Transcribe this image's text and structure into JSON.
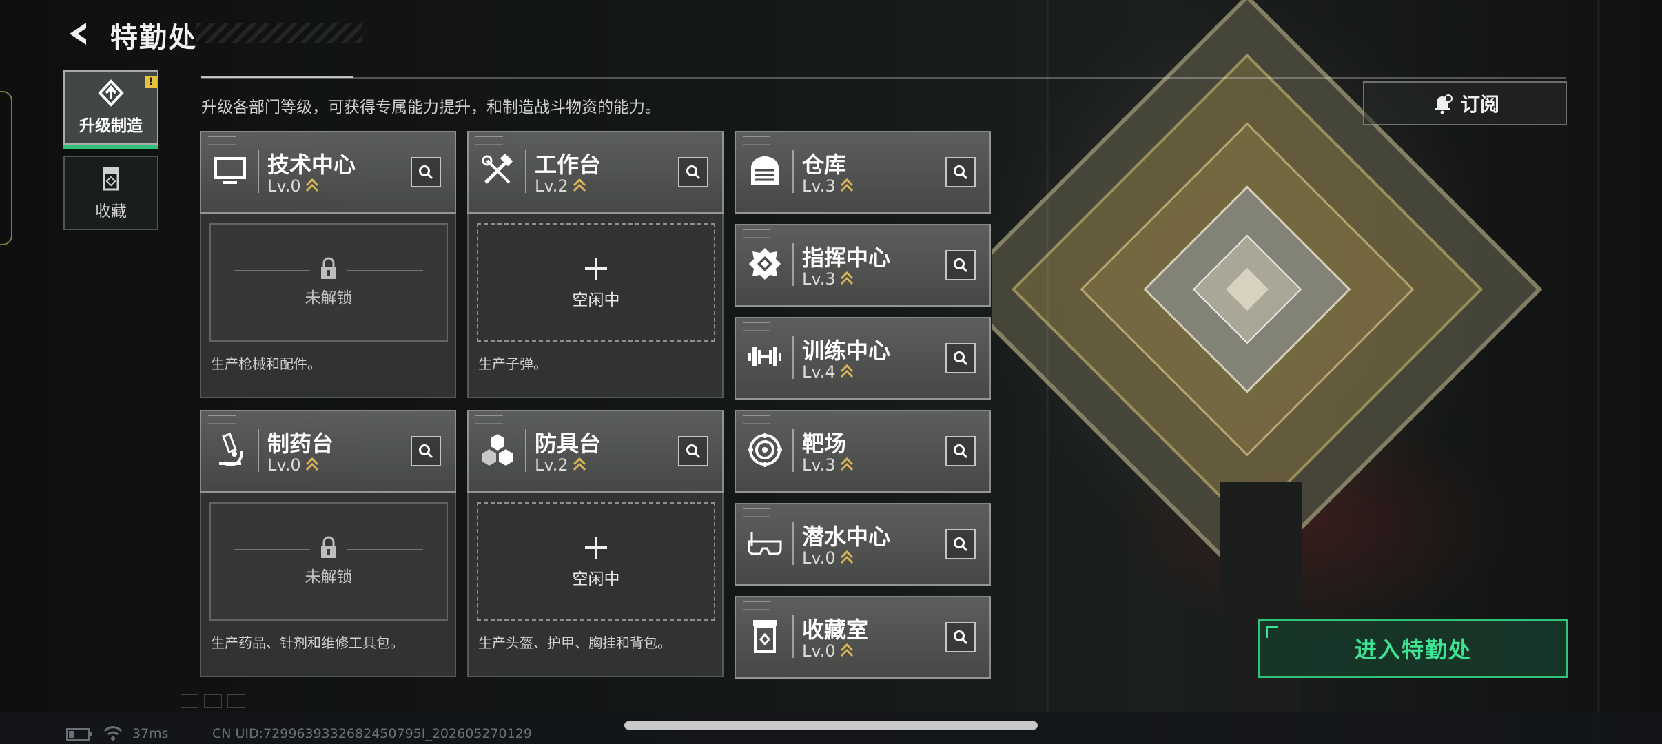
{
  "header": {
    "title": "特勤处"
  },
  "sidebar": {
    "tabs": [
      {
        "label": "升级制造",
        "active": true,
        "alert": "!"
      },
      {
        "label": "收藏",
        "active": false
      }
    ]
  },
  "description": "升级各部门等级，可获得专属能力提升，和制造战斗物资的能力。",
  "subscribe_label": "订阅",
  "enter_button": "进入特勤处",
  "facilities": [
    {
      "name": "技术中心",
      "level": "Lv.0",
      "icon": "monitor-icon",
      "slot_status": "未解锁",
      "slot_type": "locked",
      "desc": "生产枪械和配件。"
    },
    {
      "name": "工作台",
      "level": "Lv.2",
      "icon": "tools-icon",
      "slot_status": "空闲中",
      "slot_type": "idle",
      "desc": "生产子弹。"
    },
    {
      "name": "仓库",
      "level": "Lv.3",
      "icon": "warehouse-icon"
    },
    {
      "name": "指挥中心",
      "level": "Lv.3",
      "icon": "command-icon"
    },
    {
      "name": "训练中心",
      "level": "Lv.4",
      "icon": "dumbbell-icon"
    },
    {
      "name": "制药台",
      "level": "Lv.0",
      "icon": "microscope-icon",
      "slot_status": "未解锁",
      "slot_type": "locked",
      "desc": "生产药品、针剂和维修工具包。"
    },
    {
      "name": "防具台",
      "level": "Lv.2",
      "icon": "hexagons-icon",
      "slot_status": "空闲中",
      "slot_type": "idle",
      "desc": "生产头盔、护甲、胸挂和背包。"
    },
    {
      "name": "靶场",
      "level": "Lv.3",
      "icon": "target-icon"
    },
    {
      "name": "潜水中心",
      "level": "Lv.0",
      "icon": "diving-mask-icon"
    },
    {
      "name": "收藏室",
      "level": "Lv.0",
      "icon": "collection-icon"
    }
  ],
  "status_bar": {
    "ping": "37ms",
    "uid": "CN UID:7299639332682450795I_202605270129"
  },
  "colors": {
    "accent": "#2ec27a",
    "alert": "#e6c33a",
    "level_chevron": "#d9b456"
  }
}
